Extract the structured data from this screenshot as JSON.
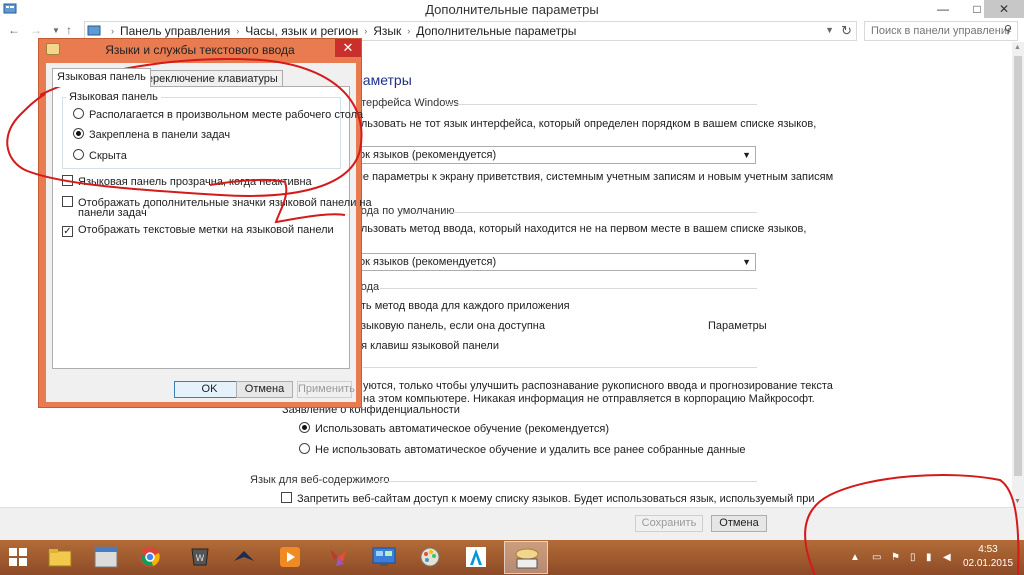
{
  "window": {
    "title": "Дополнительные параметры",
    "minimize": "—",
    "maximize": "□",
    "close": "✕"
  },
  "nav": {
    "back": "←",
    "forward": "→",
    "up": "↑",
    "breadcrumbs": [
      "Панель управления",
      "Часы, язык и регион",
      "Язык",
      "Дополнительные параметры"
    ],
    "separator": "›",
    "search_placeholder": "Поиск в панели управления"
  },
  "content": {
    "page_heading": "раметры",
    "section1_header": "нтерфейса Windows",
    "section1_desc": "ользовать не тот язык интерфейса, который определен порядком в вашем списке языков,",
    "select1_value": "ок языков (рекомендуется)",
    "link_welcome": "ые параметры к экрану приветствия, системным учетным записям и новым учетным записям",
    "section2_header": "вода по умолчанию",
    "section2_desc": "ользовать метод ввода, который находится не на первом месте в вашем списке языков,",
    "select2_value": "ок языков (рекомендуется)",
    "section3_header": "вода",
    "opt_per_app": "ать метод ввода для каждого приложения",
    "opt_langbar": "языковую панель, если она доступна",
    "link_params": "Параметры",
    "link_hotkeys": "ия клавиш языковой панели",
    "personalization_line1": "уются, только чтобы улучшить распознавание рукописного ввода и прогнозирование текста",
    "personalization_line2": "на этом компьютере. Никакая информация не отправляется в корпорацию Майкрософт.",
    "privacy_link": "Заявление о конфиденциальности",
    "radio_auto": "Использовать автоматическое обучение (рекомендуется)",
    "radio_no_auto": "Не использовать автоматическое обучение и удалить все ранее собранные данные",
    "web_header": "Язык для веб-содержимого",
    "web_checkbox": "Запретить веб-сайтам доступ к моему списку языков. Будет использоваться язык, используемый при",
    "save_button": "Сохранить",
    "cancel_button": "Отмена"
  },
  "dialog": {
    "title": "Языки и службы текстового ввода",
    "close": "✕",
    "tabs": [
      "Языковая панель",
      "Переключение клавиатуры"
    ],
    "group_label": "Языковая панель",
    "radios": [
      "Располагается в произвольном месте рабочего стола",
      "Закреплена в панели задач",
      "Скрыта"
    ],
    "selected_radio": 1,
    "checkbox_transparent": "Языковая панель прозрачна, когда неактивна",
    "checkbox_extra_line1": "Отображать дополнительные значки языковой панели на",
    "checkbox_extra_line2": "панели задач",
    "checkbox_text_labels": "Отображать текстовые метки на языковой панели",
    "checkbox_text_labels_checked": true,
    "ok": "OK",
    "cancel": "Отмена",
    "apply": "Применить"
  },
  "taskbar": {
    "time": "4:53",
    "date": "02.01.2015",
    "tray_caret": "▲"
  },
  "colors": {
    "dialog_frame": "#e87b4f",
    "taskbar": "#a15d30",
    "link": "#0066cc",
    "scribble": "#d41a1a"
  }
}
